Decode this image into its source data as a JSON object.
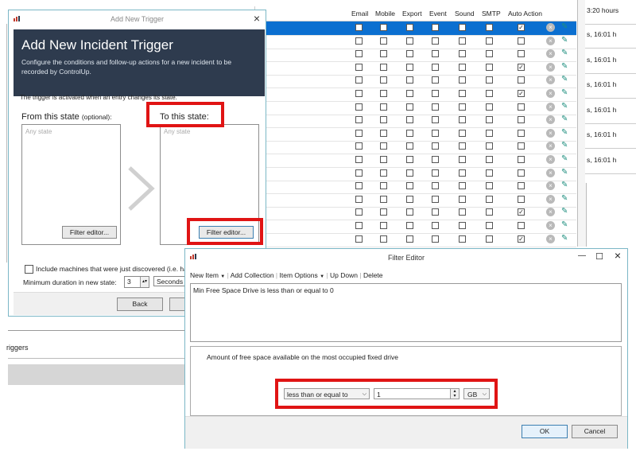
{
  "grid": {
    "columns": [
      "Email",
      "Mobile",
      "Export",
      "Event",
      "Sound",
      "SMTP",
      "Auto Action"
    ],
    "checked_auto_action_rows": [
      0,
      3,
      5,
      14,
      16
    ]
  },
  "time_column": {
    "items": [
      "3:20 hours",
      "s, 16:01 h",
      "s, 16:01 h",
      "s, 16:01 h",
      "s, 16:01 h",
      "s, 16:01 h",
      "s, 16:01 h"
    ]
  },
  "background": {
    "triggers_label": "riggers"
  },
  "add_trigger": {
    "window_title": "Add New Trigger",
    "close_glyph": "×",
    "heading": "Add New Incident Trigger",
    "description": "Configure the conditions and follow-up actions for a new incident to be recorded by ControlUp.",
    "intro": "The trigger is activated when an entry changes its state.",
    "from_label": "From this state",
    "from_optional": "(optional):",
    "to_label": "To this state:",
    "placeholder": "Any state",
    "filter_editor_button": "Filter editor...",
    "include_machines": "Include machines that were just discovered (i.e. ha",
    "min_duration_label": "Minimum duration in new state:",
    "min_duration_value": "3",
    "duration_unit": "Seconds",
    "back_button": "Back"
  },
  "filter_editor": {
    "window_title": "Filter Editor",
    "minimize_glyph": "—",
    "maximize_glyph": "☐",
    "close_glyph": "×",
    "menu": {
      "new_item": "New Item",
      "add_collection": "Add Collection",
      "item_options": "Item Options",
      "up": "Up",
      "down": "Down",
      "delete": "Delete"
    },
    "filter_expression": "Min Free Space Drive is less than or equal to 0",
    "description": "Amount of free space available on the most occupied fixed drive",
    "operator": "less than or equal to",
    "value": "1",
    "unit": "GB",
    "ok_button": "OK",
    "cancel_button": "Cancel"
  }
}
